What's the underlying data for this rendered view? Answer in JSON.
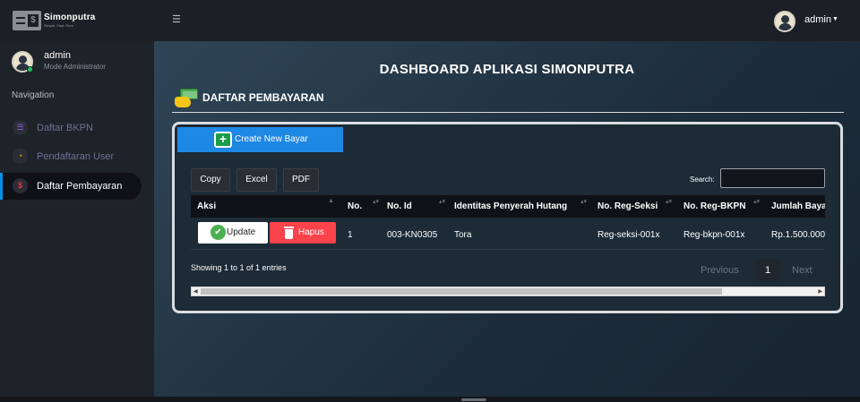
{
  "header": {
    "brand": "Simonputra",
    "brand_sub": "Simple. Fast. Pure.",
    "menu_icon": "hamburger-icon",
    "user_name": "admin"
  },
  "sidebar": {
    "user_name": "admin",
    "user_role": "Mode Administrator",
    "nav_heading": "Navigation",
    "items": [
      {
        "label": "Daftar BKPN",
        "icon": "list-icon",
        "icon_color": "#8f5fe8",
        "active": false
      },
      {
        "label": "Pendaftaran User",
        "icon": "speedometer-icon",
        "icon_color": "#ffab00",
        "active": false
      },
      {
        "label": "Daftar Pembayaran",
        "icon": "dollar-icon",
        "icon_color": "#fc424a",
        "active": true
      }
    ]
  },
  "main": {
    "page_title": "DASHBOARD APLIKASI SIMONPUTRA",
    "section_title": "DAFTAR PEMBAYARAN",
    "create_button": "Create New Bayar",
    "toolbar": [
      "Copy",
      "Excel",
      "PDF"
    ],
    "search_label": "Search:",
    "search_value": "",
    "table": {
      "columns": [
        "Aksi",
        "No.",
        "No. Id",
        "Identitas Penyerah Hutang",
        "No. Reg-Seksi",
        "No. Reg-BKPN",
        "Jumlah Bayar"
      ],
      "rows": [
        {
          "update": "Update",
          "delete": "Hapus",
          "no": "1",
          "id": "003-KN0305",
          "identitas": "Tora",
          "reg_seksi": "Reg-seksi-001x",
          "reg_bkpn": "Reg-bkpn-001x",
          "jumlah": "Rp.1.500.000"
        }
      ]
    },
    "info": "Showing 1 to 1 of 1 entries",
    "pagination": {
      "previous": "Previous",
      "current": "1",
      "next": "Next"
    }
  },
  "colors": {
    "accent_blue": "#1e88e5",
    "danger": "#fc424a",
    "success": "#4caf50",
    "active_indicator": "#0090e7"
  }
}
